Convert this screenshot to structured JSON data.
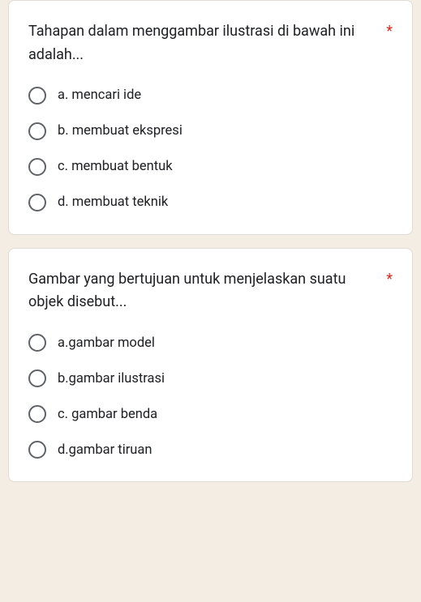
{
  "questions": [
    {
      "text": "Tahapan dalam menggambar ilustrasi di bawah ini adalah...",
      "required": "*",
      "options": [
        {
          "label": "a. mencari ide"
        },
        {
          "label": "b. membuat ekspresi"
        },
        {
          "label": "c. membuat bentuk"
        },
        {
          "label": "d. membuat teknik"
        }
      ]
    },
    {
      "text": "Gambar yang bertujuan untuk menjelaskan suatu objek disebut...",
      "required": "*",
      "options": [
        {
          "label": "a.gambar model"
        },
        {
          "label": "b.gambar ilustrasi"
        },
        {
          "label": "c. gambar benda"
        },
        {
          "label": "d.gambar tiruan"
        }
      ]
    }
  ]
}
